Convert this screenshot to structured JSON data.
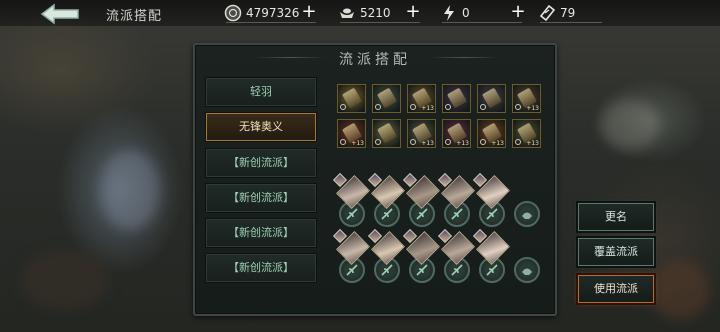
{
  "header": {
    "title": "流派搭配",
    "back_icon": "back-arrow-icon",
    "resources": [
      {
        "icon": "silver-coin-icon",
        "value": "4797326"
      },
      {
        "icon": "ingot-icon",
        "value": "5210"
      },
      {
        "icon": "lightning-icon",
        "value": "0"
      },
      {
        "icon": "ticket-icon",
        "value": "79"
      }
    ]
  },
  "panel": {
    "title": "流派搭配",
    "presets": [
      {
        "label": "轻羽",
        "selected": false
      },
      {
        "label": "无锋奥义",
        "selected": true
      },
      {
        "label": "【新创流派】",
        "selected": false
      },
      {
        "label": "【新创流派】",
        "selected": false
      },
      {
        "label": "【新创流派】",
        "selected": false
      },
      {
        "label": "【新创流派】",
        "selected": false
      }
    ],
    "equipment_row1": [
      {
        "badge": "",
        "color": "#6a5a2a"
      },
      {
        "badge": "",
        "color": "#3a4a3a"
      },
      {
        "badge": "+13",
        "color": "#5a4a2a"
      },
      {
        "badge": "",
        "color": "#3a3048"
      },
      {
        "badge": "",
        "color": "#403848"
      },
      {
        "badge": "+13",
        "color": "#4a3a2a"
      }
    ],
    "equipment_row2": [
      {
        "badge": "+13",
        "color": "#6a2a1a"
      },
      {
        "badge": "",
        "color": "#5a5a3a"
      },
      {
        "badge": "+13",
        "color": "#4a4a3a"
      },
      {
        "badge": "+13",
        "color": "#5a2a3a"
      },
      {
        "badge": "+13",
        "color": "#6a3a1a"
      },
      {
        "badge": "+13",
        "color": "#4a4a2a"
      }
    ]
  },
  "buttons": {
    "rename": "更名",
    "overwrite": "覆盖流派",
    "use": "使用流派"
  },
  "colors": {
    "accent_green": "#9fd0b4",
    "accent_orange": "#c0682a",
    "gold_border": "#6f5a2a"
  }
}
